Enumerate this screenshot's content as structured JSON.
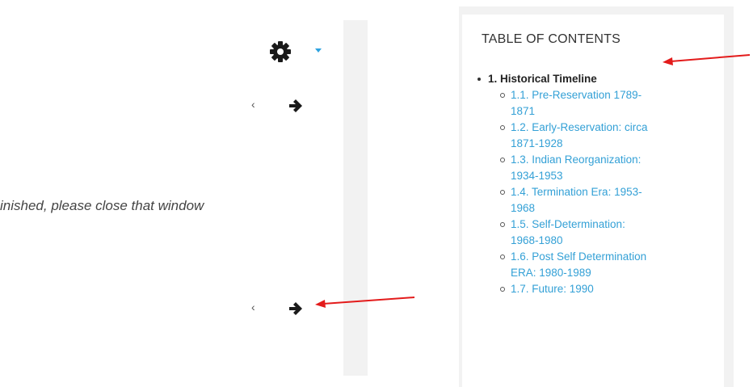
{
  "toc": {
    "title": "TABLE OF CONTENTS",
    "section": "1. Historical Timeline",
    "items": [
      {
        "label": "1.1. Pre-Reservation 1789-1871",
        "lines": [
          "1.1. Pre-Reservation 1789-",
          "1871"
        ]
      },
      {
        "label": "1.2. Early-Reservation: circa 1871-1928",
        "lines": [
          "1.2. Early-Reservation: circa",
          "1871-1928"
        ]
      },
      {
        "label": "1.3. Indian Reorganization: 1934-1953",
        "lines": [
          "1.3. Indian Reorganization:",
          "1934-1953"
        ]
      },
      {
        "label": "1.4. Termination Era: 1953-1968",
        "lines": [
          "1.4. Termination Era: 1953-",
          "1968"
        ]
      },
      {
        "label": "1.5. Self-Determination: 1968-1980",
        "lines": [
          "1.5. Self-Determination:",
          "1968-1980"
        ]
      },
      {
        "label": "1.6. Post Self Determination ERA: 1980-1989",
        "lines": [
          "1.6. Post Self Determination",
          "ERA: 1980-1989"
        ]
      },
      {
        "label": "1.7. Future: 1990",
        "lines": [
          "1.7. Future: 1990"
        ]
      }
    ]
  },
  "main": {
    "message": "inished, please close that window",
    "prev_glyph": "‹",
    "next_icon": "arrow-right-icon"
  },
  "toolbar": {
    "settings_icon": "gear-icon",
    "dropdown_icon": "caret-down-icon"
  },
  "colors": {
    "link": "#33a0d6",
    "caret": "#2ea3e0",
    "annotation": "#e31b1b",
    "panel_bg": "#f2f2f2"
  }
}
